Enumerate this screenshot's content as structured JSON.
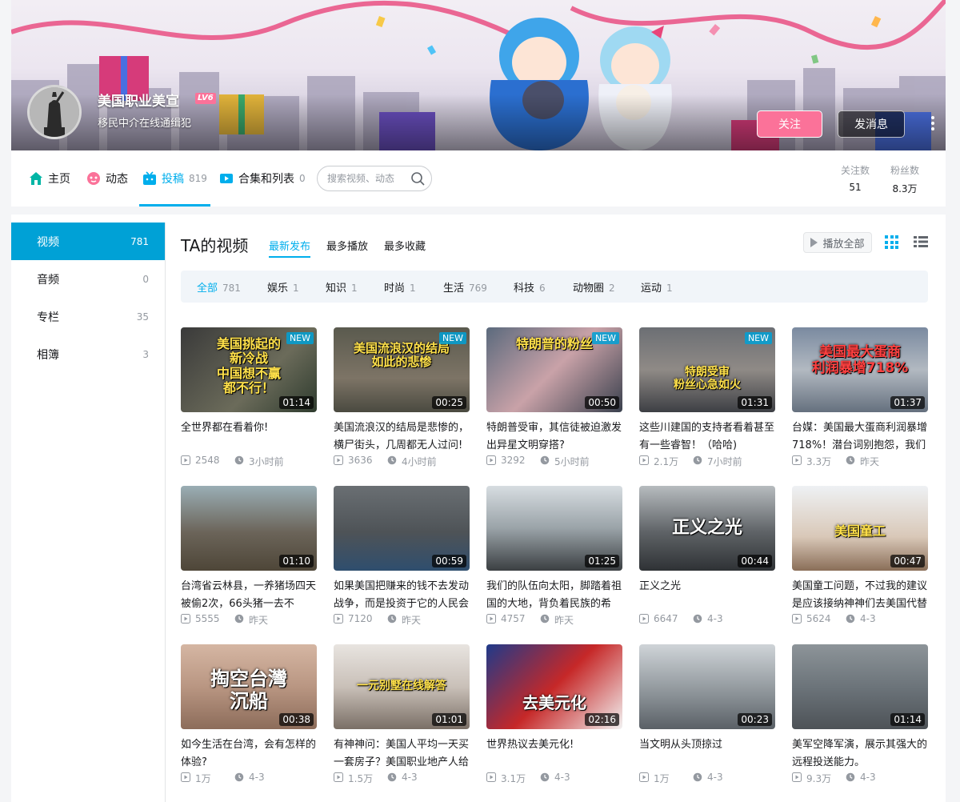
{
  "profile": {
    "name": "美国职业美宣",
    "level_badge": "LV6",
    "sign": "移民中介在线通缉犯",
    "follow_label": "关注",
    "message_label": "发消息"
  },
  "nav": {
    "home": "主页",
    "dynamic": "动态",
    "uploads": "投稿",
    "uploads_count": "819",
    "collections": "合集和列表",
    "collections_count": "0",
    "search_placeholder": "搜索视频、动态",
    "following_label": "关注数",
    "following_value": "51",
    "fans_label": "粉丝数",
    "fans_value": "8.3万"
  },
  "sidebar": [
    {
      "label": "视频",
      "count": "781"
    },
    {
      "label": "音频",
      "count": "0"
    },
    {
      "label": "专栏",
      "count": "35"
    },
    {
      "label": "相簿",
      "count": "3"
    }
  ],
  "content": {
    "title": "TA的视频",
    "tabs": [
      "最新发布",
      "最多播放",
      "最多收藏"
    ],
    "play_all": "播放全部"
  },
  "filters": [
    {
      "label": "全部",
      "count": "781"
    },
    {
      "label": "娱乐",
      "count": "1"
    },
    {
      "label": "知识",
      "count": "1"
    },
    {
      "label": "时尚",
      "count": "1"
    },
    {
      "label": "生活",
      "count": "769"
    },
    {
      "label": "科技",
      "count": "6"
    },
    {
      "label": "动物圈",
      "count": "2"
    },
    {
      "label": "运动",
      "count": "1"
    }
  ],
  "new_badge": "NEW",
  "videos": [
    {
      "title": "全世界都在看着你!",
      "duration": "01:14",
      "plays": "2548",
      "time": "3小时前",
      "new": true,
      "caption": "美国挑起的\n新冷战\n中国想不赢\n都不行！"
    },
    {
      "title": "美国流浪汉的结局是悲惨的，横尸街头，几周都无人过问!",
      "duration": "00:25",
      "plays": "3636",
      "time": "4小时前",
      "new": true,
      "caption": "美国流浪汉的结局\n如此的悲惨"
    },
    {
      "title": "特朗普受审，其信徒被迫激发出异星文明穿搭?",
      "duration": "00:50",
      "plays": "3292",
      "time": "5小时前",
      "new": true,
      "caption": "特朗普的粉丝"
    },
    {
      "title": "这些川建国的支持者看着甚至有一些睿智！（哈哈)",
      "duration": "01:31",
      "plays": "2.1万",
      "time": "7小时前",
      "new": true,
      "caption": "特朗受审\n粉丝心急如火"
    },
    {
      "title": "台媒：美国最大蛋商利润暴增718%！潜台词别抱怨，我们",
      "duration": "01:37",
      "plays": "3.3万",
      "time": "昨天",
      "new": false,
      "caption": "美国最大蛋商\n利润暴增718%"
    },
    {
      "title": "台湾省云林县，一养猪场四天被偷2次，66头猪一去不",
      "duration": "01:10",
      "plays": "5555",
      "time": "昨天",
      "new": false,
      "caption": ""
    },
    {
      "title": "如果美国把赚来的钱不去发动战争，而是投资于它的人民会",
      "duration": "00:59",
      "plays": "7120",
      "time": "昨天",
      "new": false,
      "caption": ""
    },
    {
      "title": "我们的队伍向太阳，脚踏着祖国的大地，背负着民族的希",
      "duration": "01:25",
      "plays": "4757",
      "time": "昨天",
      "new": false,
      "caption": ""
    },
    {
      "title": "正义之光",
      "duration": "00:44",
      "plays": "6647",
      "time": "4-3",
      "new": false,
      "caption": "正义之光"
    },
    {
      "title": "美国童工问题，不过我的建议是应该接纳神神们去美国代替",
      "duration": "00:47",
      "plays": "5624",
      "time": "4-3",
      "new": false,
      "caption": "美国童工"
    },
    {
      "title": "如今生活在台湾，会有怎样的体验?",
      "duration": "00:38",
      "plays": "1万",
      "time": "4-3",
      "new": false,
      "caption": "掏空台灣\n沉船"
    },
    {
      "title": "有神神问：美国人平均一天买一套房子？美国职业地产人给",
      "duration": "01:01",
      "plays": "1.5万",
      "time": "4-3",
      "new": false,
      "caption": "一元别墅在线解答"
    },
    {
      "title": "世界热议去美元化!",
      "duration": "02:16",
      "plays": "3.1万",
      "time": "4-3",
      "new": false,
      "caption": "去美元化"
    },
    {
      "title": "当文明从头顶掠过",
      "duration": "00:23",
      "plays": "1万",
      "time": "4-3",
      "new": false,
      "caption": ""
    },
    {
      "title": "美军空降军演，展示其强大的远程投送能力。",
      "duration": "01:14",
      "plays": "9.3万",
      "time": "4-3",
      "new": false,
      "caption": ""
    }
  ],
  "colors": {
    "accent": "#00aeec",
    "pink": "#fb7299"
  }
}
